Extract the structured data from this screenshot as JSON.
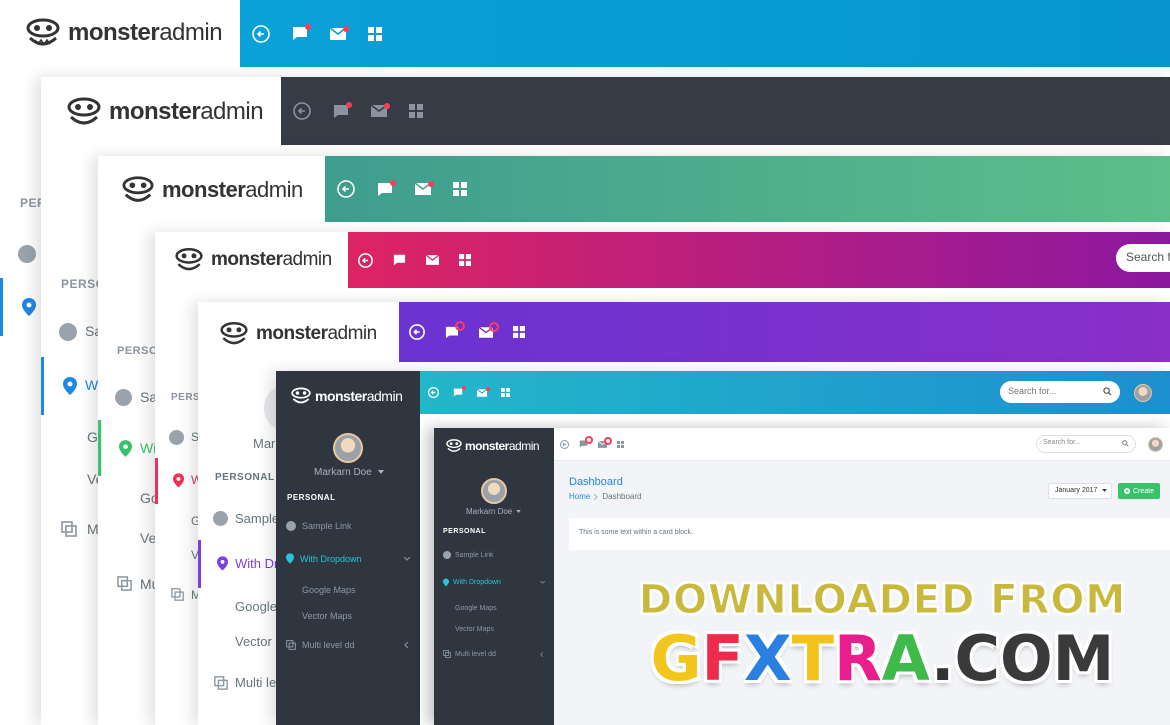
{
  "brand": {
    "bold": "monster",
    "light": "admin"
  },
  "colors": {
    "bar1": "#0796cf",
    "bar2": "#363b46",
    "bar3": "#48a98a",
    "bar4a": "#dd2463",
    "bar4b": "#8d18a0",
    "bar5": "#6a33d2",
    "bar6": "#1d9ed4",
    "accent_blue": "#1e88e5",
    "accent_green": "#39c26c",
    "accent_red": "#ef2f57",
    "accent_purple": "#7b3fe4",
    "accent_teal": "#26c6da"
  },
  "icons": {
    "back": "arrow-left-circle-icon",
    "chat": "chat-bubble-icon",
    "mail": "envelope-icon",
    "apps": "grid-icon",
    "search": "search-icon",
    "pin": "map-pin-icon",
    "layers": "layers-icon"
  },
  "sidebar": {
    "section_label": "PERSONAL",
    "user_name": "Markarn Doe",
    "items": [
      {
        "label": "Sample Link"
      },
      {
        "label": "With Dropdown"
      },
      {
        "label": "Google Maps"
      },
      {
        "label": "Vector Maps"
      },
      {
        "label": "Multi level dd"
      }
    ],
    "partial": {
      "perso": "PERSO",
      "per": "PER",
      "sa": "Sa",
      "s": "S",
      "w": "W",
      "wi": "Wi",
      "with_dr": "With Dr",
      "go": "Go",
      "google": "Google",
      "g": "G",
      "ve": "Ve",
      "v": "V",
      "vector": "Vector",
      "m": "M",
      "mu": "Mu",
      "multi_le": "Multi le",
      "mar": "Mar",
      "sample": "Sample"
    }
  },
  "search": {
    "placeholder": "Search for...",
    "partial": "Search fo"
  },
  "dashboard": {
    "title": "Dashboard",
    "breadcrumb_home": "Home",
    "breadcrumb_current": "Dashboard",
    "date_select": "January 2017",
    "create_button": "Create",
    "card_text": "This is some text within a card block."
  },
  "watermark": {
    "line1": "DOWNLOADED FROM",
    "line2_parts": [
      "G",
      "F",
      "X",
      "T",
      "R",
      "A",
      "."
    ],
    "line2_tail": "COM"
  }
}
